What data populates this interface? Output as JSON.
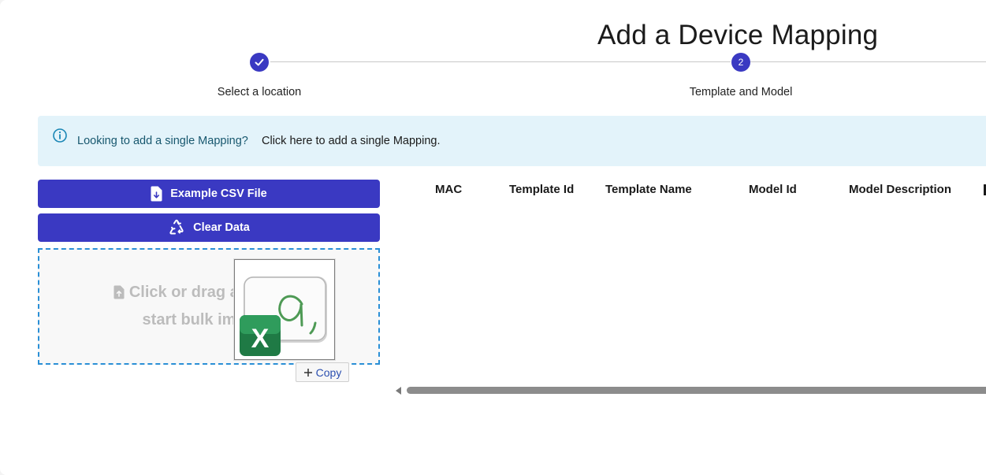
{
  "page": {
    "title": "Add a Device Mapping"
  },
  "stepper": {
    "steps": [
      {
        "label": "Select a location",
        "status": "complete"
      },
      {
        "label": "Template and Model",
        "number": "2",
        "status": "active"
      }
    ]
  },
  "info_banner": {
    "icon": "info-icon",
    "text": "Looking to add a single Mapping?",
    "link_text": "Click here to add a single Mapping."
  },
  "actions": {
    "example_csv_label": "Example CSV File",
    "clear_data_label": "Clear Data"
  },
  "dropzone": {
    "line1": "Click or drag a CS",
    "line2": "start bulk im"
  },
  "drag_overlay": {
    "icon": "excel-file-icon",
    "copy_label": "Copy"
  },
  "table": {
    "columns": [
      "MAC",
      "Template Id",
      "Template Name",
      "Model Id",
      "Model Description"
    ]
  },
  "colors": {
    "primary": "#3a39c2",
    "banner_bg": "#e3f3fa",
    "dropzone_border": "#2a8fd6"
  }
}
